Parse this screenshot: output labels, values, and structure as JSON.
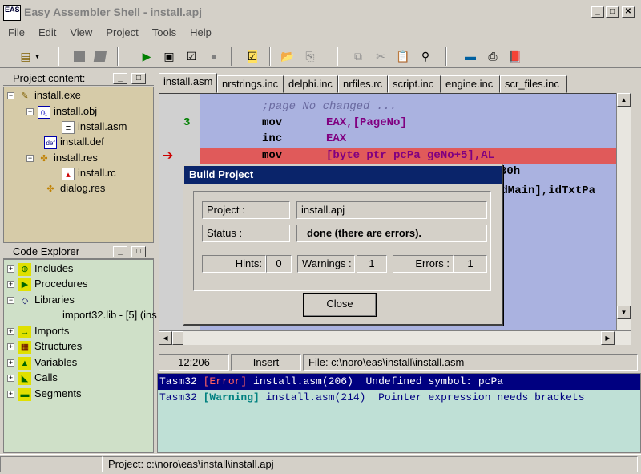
{
  "window": {
    "title": "Easy Assembler Shell  - install.apj",
    "icon_label": "EAS"
  },
  "menu": [
    "File",
    "Edit",
    "View",
    "Project",
    "Tools",
    "Help"
  ],
  "project_panel": {
    "header": "Project content:",
    "items": [
      {
        "label": "install.exe",
        "icon": "exe-icon"
      },
      {
        "label": "install.obj",
        "icon": "obj-icon"
      },
      {
        "label": "install.asm",
        "icon": "asm-file-icon"
      },
      {
        "label": "install.def",
        "icon": "def-file-icon"
      },
      {
        "label": "install.res",
        "icon": "res-icon"
      },
      {
        "label": "install.rc",
        "icon": "rc-file-icon"
      },
      {
        "label": "dialog.res",
        "icon": "res-icon"
      }
    ]
  },
  "code_explorer": {
    "header": "Code Explorer",
    "items": [
      {
        "label": "Includes"
      },
      {
        "label": "Procedures"
      },
      {
        "label": "Libraries"
      },
      {
        "label": "import32.lib - [5] (ins"
      },
      {
        "label": "Imports"
      },
      {
        "label": "Structures"
      },
      {
        "label": "Variables"
      },
      {
        "label": "Calls"
      },
      {
        "label": "Segments"
      }
    ]
  },
  "tabs": [
    "install.asm",
    "nrstrings.inc",
    "delphi.inc",
    "nrfiles.rc",
    "script.inc",
    "engine.inc",
    "scr_files.inc"
  ],
  "editor": {
    "line_marker": "3",
    "lines": [
      {
        "kw": "",
        "arg": ";page No changed ..."
      },
      {
        "kw": "mov",
        "arg": "EAX,[PageNo]"
      },
      {
        "kw": "inc",
        "arg": "EAX"
      },
      {
        "kw": "mov",
        "arg": "[byte ptr pcPa geNo+5],AL"
      },
      {
        "kw": "",
        "arg": "30h"
      },
      {
        "kw": "",
        "arg": "ndMain],idTxtPa"
      }
    ]
  },
  "status": {
    "position": "12:206",
    "mode": "Insert",
    "file": "File: c:\\noro\\eas\\install\\install.asm"
  },
  "messages": [
    {
      "tool": "Tasm32",
      "level": "[Error]",
      "file": "install.asm(206)",
      "text": "Undefined symbol: pcPa"
    },
    {
      "tool": "Tasm32",
      "level": "[Warning]",
      "file": "install.asm(214)",
      "text": "Pointer expression needs brackets"
    }
  ],
  "bottom_status": "Project: c:\\noro\\eas\\install\\install.apj",
  "dialog": {
    "title": "Build Project",
    "project_label": "Project :",
    "project_value": "install.apj",
    "status_label": "Status :",
    "status_value": "done (there are errors).",
    "hints_label": "Hints:",
    "hints_value": "0",
    "warnings_label": "Warnings :",
    "warnings_value": "1",
    "errors_label": "Errors :",
    "errors_value": "1",
    "close_label": "Close"
  },
  "colors": {
    "error_line": "#e05a5a",
    "editor_bg": "#aab2e0",
    "selection": "#000080"
  }
}
